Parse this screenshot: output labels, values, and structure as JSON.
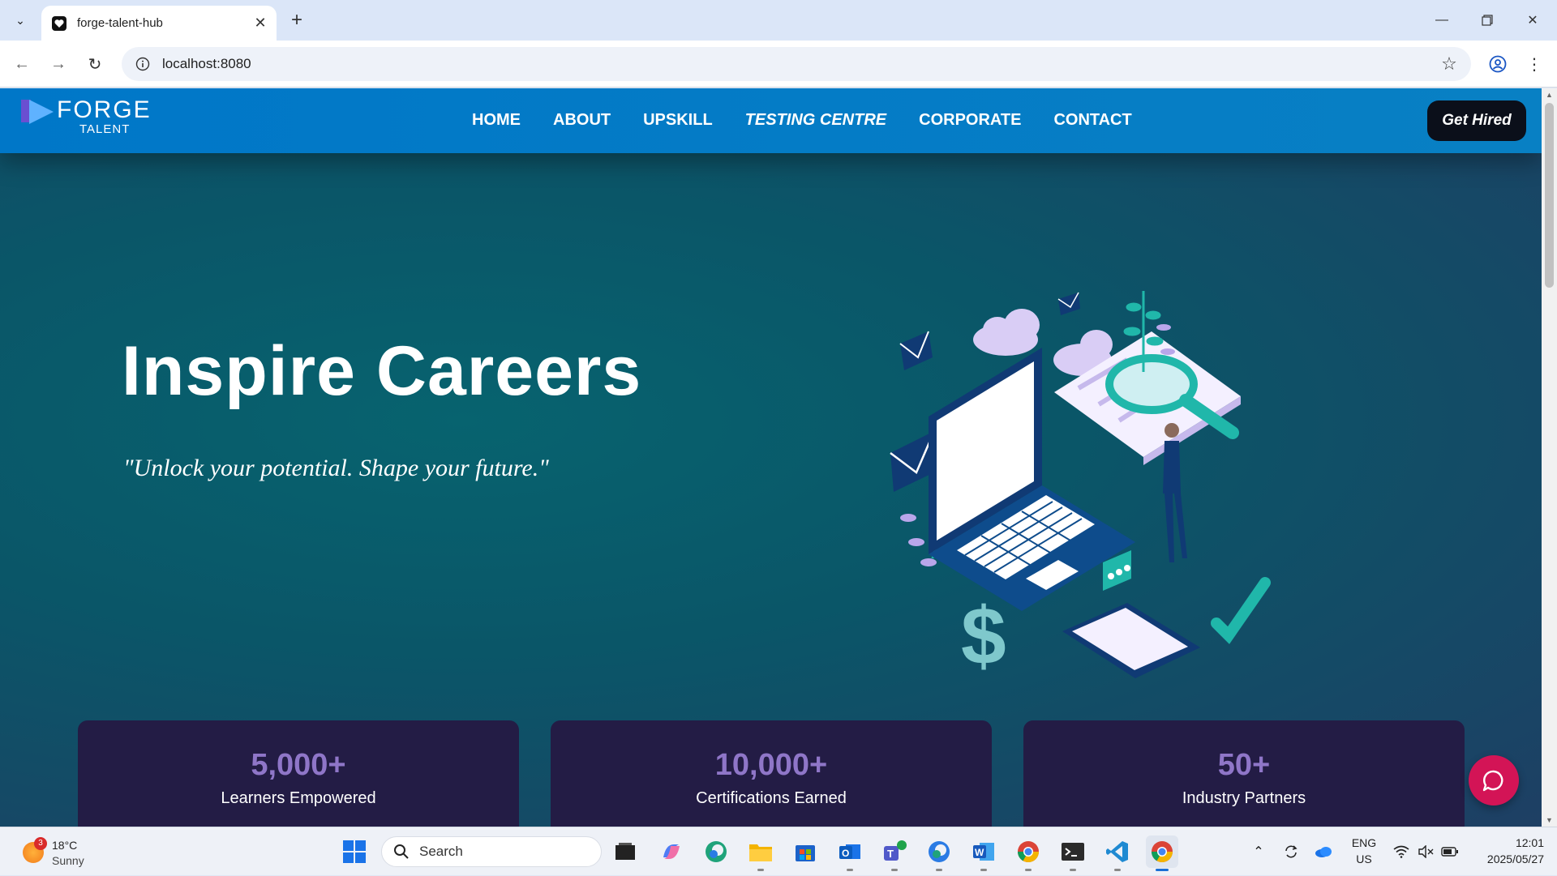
{
  "browser": {
    "tab_title": "forge-talent-hub",
    "url": "localhost:8080"
  },
  "site": {
    "logo_word": "FORGE",
    "logo_sub": "TALENT",
    "nav": [
      "HOME",
      "ABOUT",
      "UPSKILL",
      "TESTING CENTRE",
      "CORPORATE",
      "CONTACT"
    ],
    "cta_label": "Get Hired",
    "hero_title": "Inspire Careers",
    "hero_tagline": "\"Unlock your potential. Shape your future.\"",
    "stats": [
      {
        "value": "5,000+",
        "label": "Learners Empowered"
      },
      {
        "value": "10,000+",
        "label": "Certifications Earned"
      },
      {
        "value": "50+",
        "label": "Industry Partners"
      }
    ]
  },
  "taskbar": {
    "weather_temp": "18°C",
    "weather_cond": "Sunny",
    "weather_badge": "3",
    "search_label": "Search",
    "lang_1": "ENG",
    "lang_2": "US",
    "time": "12:01",
    "date": "2025/05/27"
  },
  "colors": {
    "header": "#0077c8",
    "cta_bg": "#0b0f1a",
    "stat_card": "#231c45",
    "stat_number": "#8f76c8",
    "chat_fab": "#d31456"
  }
}
